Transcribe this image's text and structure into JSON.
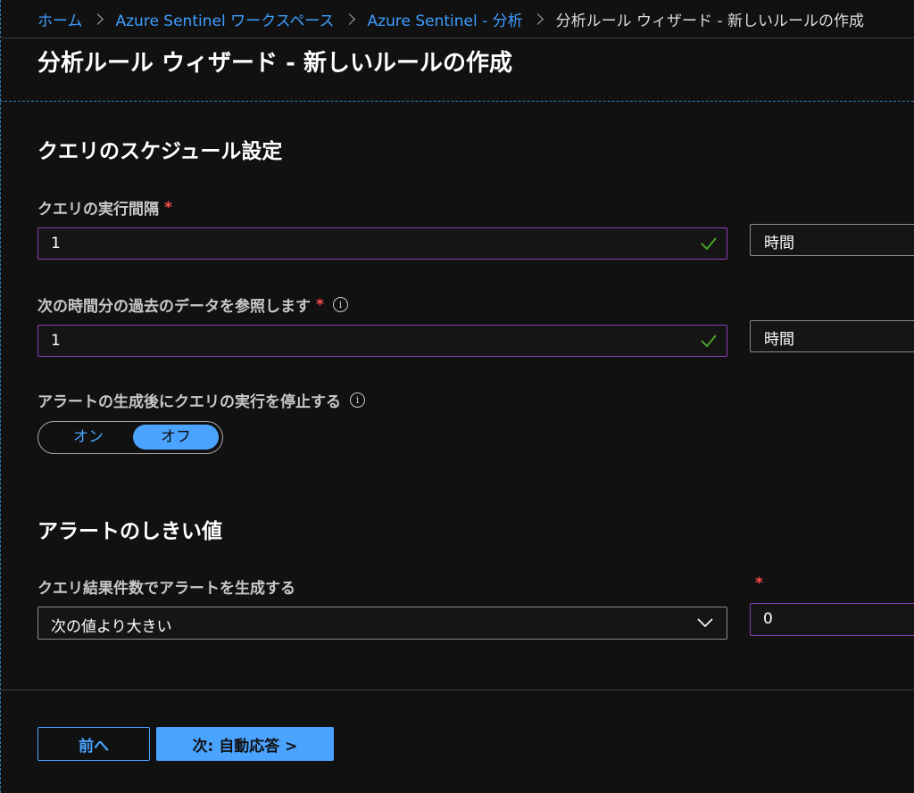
{
  "breadcrumb": {
    "items": [
      "ホーム",
      "Azure Sentinel ワークスペース",
      "Azure Sentinel - 分析",
      "分析ルール ウィザード - 新しいルールの作成"
    ]
  },
  "page": {
    "title": "分析ルール ウィザード - 新しいルールの作成"
  },
  "schedule": {
    "section_title": "クエリのスケジュール設定",
    "run_interval": {
      "label": "クエリの実行間隔",
      "required_mark": "*",
      "value": "1",
      "unit": "時間"
    },
    "lookback": {
      "label": "次の時間分の過去のデータを参照します",
      "required_mark": "*",
      "info_glyph": "i",
      "value": "1",
      "unit": "時間"
    },
    "suppression": {
      "label": "アラートの生成後にクエリの実行を停止する",
      "info_glyph": "i",
      "on_label": "オン",
      "off_label": "オフ",
      "selected": "オフ"
    }
  },
  "threshold": {
    "section_title": "アラートのしきい値",
    "label": "クエリ結果件数でアラートを生成する",
    "required_mark": "*",
    "operator": "次の値より大きい",
    "value": "0"
  },
  "footer": {
    "prev_label": "前へ",
    "next_label": "次: 自動応答 >"
  },
  "colors": {
    "accent": "#4aa3ff",
    "link": "#3d9eff",
    "input_border": "#8c3fb5",
    "valid_check": "#4caf2a",
    "required": "#ff4c4c",
    "background": "#111111"
  },
  "icons": {
    "breadcrumb_separator": "chevron-right-icon",
    "valid": "checkmark-icon",
    "info": "info-icon",
    "dropdown": "chevron-down-icon"
  }
}
